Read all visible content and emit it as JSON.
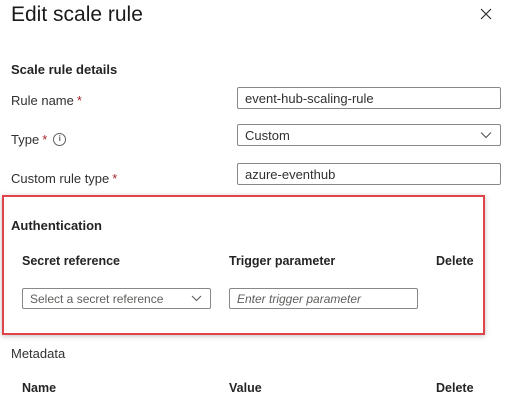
{
  "panel": {
    "title": "Edit scale rule"
  },
  "details": {
    "heading": "Scale rule details",
    "rule_name_label": "Rule name",
    "rule_name_value": "event-hub-scaling-rule",
    "type_label": "Type",
    "type_value": "Custom",
    "custom_rule_type_label": "Custom rule type",
    "custom_rule_type_value": "azure-eventhub",
    "required_marker": "*"
  },
  "authentication": {
    "heading": "Authentication",
    "col_secret": "Secret reference",
    "col_trigger": "Trigger parameter",
    "col_delete": "Delete",
    "secret_placeholder": "Select a secret reference",
    "trigger_placeholder": "Enter trigger parameter"
  },
  "metadata": {
    "heading": "Metadata",
    "col_name": "Name",
    "col_value": "Value",
    "col_delete": "Delete"
  },
  "colors": {
    "highlight": "#e0434a",
    "required": "#a4262c",
    "border": "#8a8886"
  },
  "icons": {
    "close": "close-icon",
    "info": "info-icon",
    "chevron": "chevron-down-icon"
  }
}
